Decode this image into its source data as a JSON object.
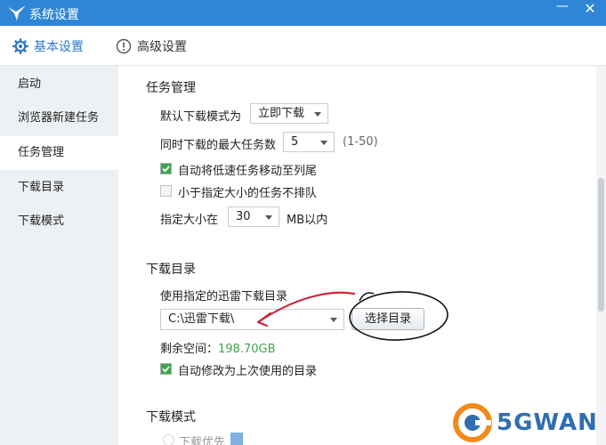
{
  "window": {
    "title": "系统设置",
    "min_label": "—",
    "close_label": "✕"
  },
  "tabs": [
    {
      "label": "基本设置",
      "icon": "gear-icon",
      "active": true
    },
    {
      "label": "高级设置",
      "icon": "info-circle-icon",
      "active": false
    }
  ],
  "sidebar": {
    "items": [
      {
        "label": "启动"
      },
      {
        "label": "浏览器新建任务"
      },
      {
        "label": "任务管理",
        "active": true
      },
      {
        "label": "下载目录"
      },
      {
        "label": "下载模式"
      }
    ]
  },
  "task_mgmt": {
    "title": "任务管理",
    "default_mode_label": "默认下载模式为",
    "default_mode_value": "立即下载",
    "max_tasks_label": "同时下载的最大任务数",
    "max_tasks_value": "5",
    "max_tasks_range": "(1-50)",
    "auto_move_label": "自动将低速任务移动至列尾",
    "auto_move_checked": true,
    "no_queue_label": "小于指定大小的任务不排队",
    "no_queue_checked": false,
    "size_label": "指定大小在",
    "size_value": "30",
    "size_unit": "MB以内"
  },
  "download_dir": {
    "title": "下载目录",
    "use_label": "使用指定的迅雷下载目录",
    "path_value": "C:\\迅雷下载\\",
    "choose_button": "选择目录",
    "free_space_label": "剩余空间：",
    "free_space_value": "198.70GB",
    "auto_modify_label": "自动修改为上次使用的目录",
    "auto_modify_checked": true
  },
  "download_mode": {
    "title": "下载模式",
    "partial_label": "下载优先"
  },
  "watermark": {
    "text": "5GWAN"
  },
  "colors": {
    "titlebar": "#2f86d6",
    "accent": "#2f78c5",
    "space_green": "#3da64a",
    "annotation_red": "#c8283a"
  }
}
